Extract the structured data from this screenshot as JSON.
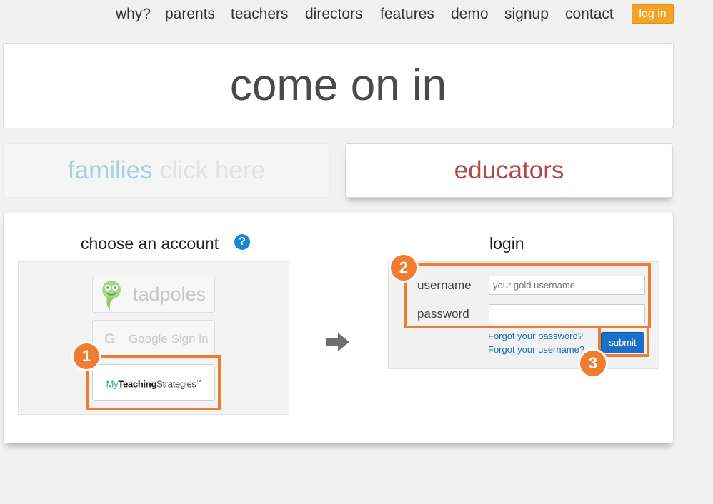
{
  "nav": {
    "items": [
      "why?",
      "parents",
      "teachers",
      "directors",
      "features",
      "demo",
      "signup",
      "contact"
    ],
    "login_label": "log in"
  },
  "hero": {
    "title": "come on in"
  },
  "tabs": {
    "families_a": "families",
    "families_b": "click here",
    "educators": "educators"
  },
  "choose": {
    "title": "choose an account",
    "help_glyph": "?",
    "tadpoles_label": "tadpoles",
    "google_glyph": "G",
    "google_label": "Google Sign in",
    "mts_part1": "My",
    "mts_part2": "Teaching",
    "mts_part3": "Strategies",
    "mts_mark": "™"
  },
  "login": {
    "title": "login",
    "username_label": "username",
    "username_placeholder": "your gold username",
    "username_value": "",
    "password_label": "password",
    "password_value": "",
    "forgot_password": "Forgot your password?",
    "forgot_username": "Forgot your username?",
    "submit_label": "submit"
  },
  "annotations": [
    "1",
    "2",
    "3"
  ],
  "colors": {
    "accent_orange": "#f07c2f",
    "login_button": "#f5a322",
    "submit_button": "#1a6fca",
    "educators_text": "#b24a4a",
    "families_text": "#a9cfe0"
  },
  "icons": {
    "help": "question-circle-icon",
    "tadpoles": "tadpole-logo-icon",
    "google": "google-g-icon",
    "arrow": "arrow-right-icon"
  }
}
